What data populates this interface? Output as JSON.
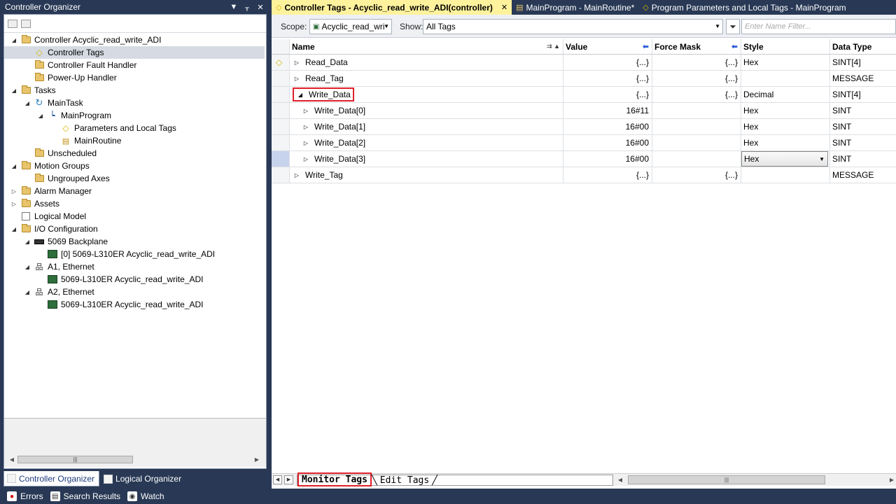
{
  "left_panel": {
    "title": "Controller Organizer",
    "title_buttons": [
      "▼",
      "ᚁ",
      "✕"
    ],
    "tree": [
      {
        "label": "Controller Acyclic_read_write_ADI",
        "icon": "folder-icon",
        "twisty": "◢",
        "depth": 0
      },
      {
        "label": "Controller Tags",
        "icon": "tag-icon",
        "twisty": "",
        "depth": 1,
        "selected": true
      },
      {
        "label": "Controller Fault Handler",
        "icon": "folder-icon",
        "twisty": "",
        "depth": 1
      },
      {
        "label": "Power-Up Handler",
        "icon": "folder-icon",
        "twisty": "",
        "depth": 1
      },
      {
        "label": "Tasks",
        "icon": "folder-icon",
        "twisty": "◢",
        "depth": 0
      },
      {
        "label": "MainTask",
        "icon": "task-icon",
        "twisty": "◢",
        "depth": 1
      },
      {
        "label": "MainProgram",
        "icon": "program-icon",
        "twisty": "◢",
        "depth": 2
      },
      {
        "label": "Parameters and Local Tags",
        "icon": "tag-icon",
        "twisty": "",
        "depth": 3
      },
      {
        "label": "MainRoutine",
        "icon": "routine-icon",
        "twisty": "",
        "depth": 3
      },
      {
        "label": "Unscheduled",
        "icon": "folder-icon",
        "twisty": "",
        "depth": 1
      },
      {
        "label": "Motion Groups",
        "icon": "folder-icon",
        "twisty": "◢",
        "depth": 0
      },
      {
        "label": "Ungrouped Axes",
        "icon": "folder-icon",
        "twisty": "",
        "depth": 1
      },
      {
        "label": "Alarm Manager",
        "icon": "folder-icon",
        "twisty": "▷",
        "depth": 0
      },
      {
        "label": "Assets",
        "icon": "folder-icon",
        "twisty": "▷",
        "depth": 0
      },
      {
        "label": "Logical Model",
        "icon": "logical-model-icon",
        "twisty": "",
        "depth": 0
      },
      {
        "label": "I/O Configuration",
        "icon": "folder-icon",
        "twisty": "◢",
        "depth": 0
      },
      {
        "label": "5069 Backplane",
        "icon": "backplane-icon",
        "twisty": "◢",
        "depth": 1
      },
      {
        "label": "[0] 5069-L310ER Acyclic_read_write_ADI",
        "icon": "module-icon",
        "twisty": "",
        "depth": 2
      },
      {
        "label": "A1, Ethernet",
        "icon": "network-icon",
        "twisty": "◢",
        "depth": 1
      },
      {
        "label": "5069-L310ER Acyclic_read_write_ADI",
        "icon": "module-icon",
        "twisty": "",
        "depth": 2
      },
      {
        "label": "A2, Ethernet",
        "icon": "network-icon",
        "twisty": "◢",
        "depth": 1
      },
      {
        "label": "5069-L310ER Acyclic_read_write_ADI",
        "icon": "module-icon",
        "twisty": "",
        "depth": 2
      }
    ],
    "tabs": [
      {
        "label": "Controller Organizer",
        "active": true
      },
      {
        "label": "Logical Organizer",
        "active": false
      }
    ]
  },
  "bottom_bar": {
    "items": [
      {
        "label": "Errors",
        "icon": "errors-icon"
      },
      {
        "label": "Search Results",
        "icon": "search-results-icon"
      },
      {
        "label": "Watch",
        "icon": "watch-icon"
      }
    ]
  },
  "document_tabs": [
    {
      "label": "Controller Tags - Acyclic_read_write_ADI(controller)",
      "active": true,
      "close": "✕",
      "icon": "tag-icon"
    },
    {
      "label": "MainProgram - MainRoutine*",
      "active": false,
      "icon": "routine-icon"
    },
    {
      "label": "Program Parameters and Local Tags - MainProgram",
      "active": false,
      "icon": "tag-icon"
    }
  ],
  "scope_bar": {
    "scope_label": "Scope:",
    "scope_value": "Acyclic_read_wri",
    "show_label": "Show:",
    "show_value": "All Tags",
    "filter_placeholder": "Enter Name Filter..."
  },
  "tag_grid": {
    "headers": {
      "name": "Name",
      "value": "Value",
      "force_mask": "Force Mask",
      "style": "Style",
      "data_type": "Data Type"
    },
    "rows": [
      {
        "name": "Read_Data",
        "twisty": "▷",
        "indent": 0,
        "value": "{...}",
        "force": "{...}",
        "style": "Hex",
        "type": "SINT[4]",
        "marker": "tag"
      },
      {
        "name": "Read_Tag",
        "twisty": "▷",
        "indent": 0,
        "value": "{...}",
        "force": "{...}",
        "style": "",
        "type": "MESSAGE"
      },
      {
        "name": "Write_Data",
        "twisty": "◢",
        "indent": 0,
        "value": "{...}",
        "force": "{...}",
        "style": "Decimal",
        "type": "SINT[4]",
        "highlight": true
      },
      {
        "name": "Write_Data[0]",
        "twisty": "▷",
        "indent": 1,
        "value": "16#11",
        "force": "",
        "style": "Hex",
        "type": "SINT"
      },
      {
        "name": "Write_Data[1]",
        "twisty": "▷",
        "indent": 1,
        "value": "16#00",
        "force": "",
        "style": "Hex",
        "type": "SINT"
      },
      {
        "name": "Write_Data[2]",
        "twisty": "▷",
        "indent": 1,
        "value": "16#00",
        "force": "",
        "style": "Hex",
        "type": "SINT"
      },
      {
        "name": "Write_Data[3]",
        "twisty": "▷",
        "indent": 1,
        "value": "16#00",
        "force": "",
        "style": "Hex",
        "type": "SINT",
        "current": true,
        "style_combo": true
      },
      {
        "name": "Write_Tag",
        "twisty": "▷",
        "indent": 0,
        "value": "{...}",
        "force": "{...}",
        "style": "",
        "type": "MESSAGE"
      }
    ]
  },
  "sheet_tabs": {
    "monitor": "Monitor Tags",
    "edit": "Edit Tags"
  },
  "colors": {
    "chrome": "#293955",
    "active_doc_tab": "#fff29d",
    "highlight_red": "#e0202a"
  }
}
